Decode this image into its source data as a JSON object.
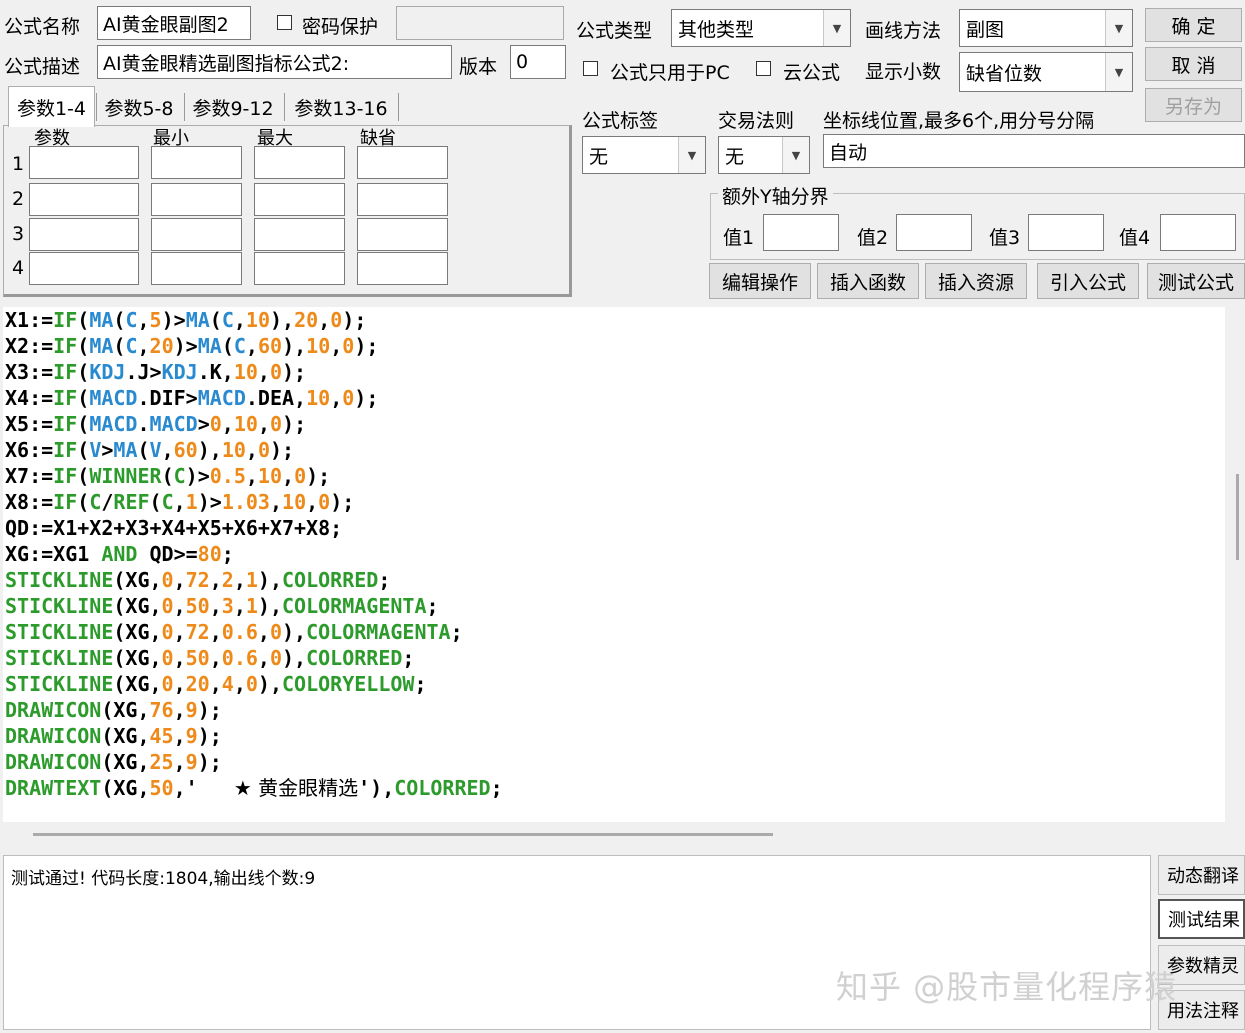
{
  "header": {
    "name_label": "公式名称",
    "name_value": "AI黄金眼副图2",
    "password_label": "密码保护",
    "password_value": "",
    "desc_label": "公式描述",
    "desc_value": "AI黄金眼精选副图指标公式2:",
    "version_label": "版本",
    "version_value": "0",
    "type_label": "公式类型",
    "type_value": "其他类型",
    "draw_label": "画线方法",
    "draw_value": "副图",
    "pc_only_label": "公式只用于PC",
    "cloud_label": "云公式",
    "decimal_label": "显示小数",
    "decimal_value": "缺省位数"
  },
  "buttons": {
    "ok": "确 定",
    "cancel": "取 消",
    "save_as": "另存为"
  },
  "tabs": [
    "参数1-4",
    "参数5-8",
    "参数9-12",
    "参数13-16"
  ],
  "params": {
    "headers": [
      "参数",
      "最小",
      "最大",
      "缺省"
    ],
    "rows": [
      "1",
      "2",
      "3",
      "4"
    ]
  },
  "tags": {
    "tag_label": "公式标签",
    "tag_value": "无",
    "rule_label": "交易法则",
    "rule_value": "无",
    "axis_label": "坐标线位置,最多6个,用分号分隔",
    "axis_value": "自动"
  },
  "extra_axis": {
    "title": "额外Y轴分界",
    "v1": "值1",
    "v2": "值2",
    "v3": "值3",
    "v4": "值4"
  },
  "toolbar": [
    "编辑操作",
    "插入函数",
    "插入资源",
    "引入公式",
    "测试公式"
  ],
  "code": [
    [
      [
        "p",
        "X1:="
      ],
      [
        "f",
        "IF"
      ],
      [
        "p",
        "("
      ],
      [
        "i",
        "MA"
      ],
      [
        "p",
        "("
      ],
      [
        "i",
        "C"
      ],
      [
        "p",
        ","
      ],
      [
        "n",
        "5"
      ],
      [
        "p",
        ")>"
      ],
      [
        "i",
        "MA"
      ],
      [
        "p",
        "("
      ],
      [
        "i",
        "C"
      ],
      [
        "p",
        ","
      ],
      [
        "n",
        "10"
      ],
      [
        "p",
        "),"
      ],
      [
        "n",
        "20"
      ],
      [
        "p",
        ","
      ],
      [
        "n",
        "0"
      ],
      [
        "p",
        ");"
      ]
    ],
    [
      [
        "p",
        "X2:="
      ],
      [
        "f",
        "IF"
      ],
      [
        "p",
        "("
      ],
      [
        "i",
        "MA"
      ],
      [
        "p",
        "("
      ],
      [
        "i",
        "C"
      ],
      [
        "p",
        ","
      ],
      [
        "n",
        "20"
      ],
      [
        "p",
        ")>"
      ],
      [
        "i",
        "MA"
      ],
      [
        "p",
        "("
      ],
      [
        "i",
        "C"
      ],
      [
        "p",
        ","
      ],
      [
        "n",
        "60"
      ],
      [
        "p",
        "),"
      ],
      [
        "n",
        "10"
      ],
      [
        "p",
        ","
      ],
      [
        "n",
        "0"
      ],
      [
        "p",
        ");"
      ]
    ],
    [
      [
        "p",
        "X3:="
      ],
      [
        "f",
        "IF"
      ],
      [
        "p",
        "("
      ],
      [
        "i",
        "KDJ"
      ],
      [
        "p",
        ".J>"
      ],
      [
        "i",
        "KDJ"
      ],
      [
        "p",
        ".K,"
      ],
      [
        "n",
        "10"
      ],
      [
        "p",
        ","
      ],
      [
        "n",
        "0"
      ],
      [
        "p",
        ");"
      ]
    ],
    [
      [
        "p",
        "X4:="
      ],
      [
        "f",
        "IF"
      ],
      [
        "p",
        "("
      ],
      [
        "i",
        "MACD"
      ],
      [
        "p",
        ".DIF>"
      ],
      [
        "i",
        "MACD"
      ],
      [
        "p",
        ".DEA,"
      ],
      [
        "n",
        "10"
      ],
      [
        "p",
        ","
      ],
      [
        "n",
        "0"
      ],
      [
        "p",
        ");"
      ]
    ],
    [
      [
        "p",
        "X5:="
      ],
      [
        "f",
        "IF"
      ],
      [
        "p",
        "("
      ],
      [
        "i",
        "MACD"
      ],
      [
        "p",
        "."
      ],
      [
        "i",
        "MACD"
      ],
      [
        "p",
        ">"
      ],
      [
        "n",
        "0"
      ],
      [
        "p",
        ","
      ],
      [
        "n",
        "10"
      ],
      [
        "p",
        ","
      ],
      [
        "n",
        "0"
      ],
      [
        "p",
        ");"
      ]
    ],
    [
      [
        "p",
        "X6:="
      ],
      [
        "f",
        "IF"
      ],
      [
        "p",
        "("
      ],
      [
        "i",
        "V"
      ],
      [
        "p",
        ">"
      ],
      [
        "i",
        "MA"
      ],
      [
        "p",
        "("
      ],
      [
        "i",
        "V"
      ],
      [
        "p",
        ","
      ],
      [
        "n",
        "60"
      ],
      [
        "p",
        "),"
      ],
      [
        "n",
        "10"
      ],
      [
        "p",
        ","
      ],
      [
        "n",
        "0"
      ],
      [
        "p",
        ");"
      ]
    ],
    [
      [
        "p",
        "X7:="
      ],
      [
        "f",
        "IF"
      ],
      [
        "p",
        "("
      ],
      [
        "f",
        "WINNER"
      ],
      [
        "p",
        "("
      ],
      [
        "f",
        "C"
      ],
      [
        "p",
        ")>"
      ],
      [
        "n",
        "0.5"
      ],
      [
        "p",
        ","
      ],
      [
        "n",
        "10"
      ],
      [
        "p",
        ","
      ],
      [
        "n",
        "0"
      ],
      [
        "p",
        ");"
      ]
    ],
    [
      [
        "p",
        "X8:="
      ],
      [
        "f",
        "IF"
      ],
      [
        "p",
        "("
      ],
      [
        "f",
        "C"
      ],
      [
        "p",
        "/"
      ],
      [
        "f",
        "REF"
      ],
      [
        "p",
        "("
      ],
      [
        "f",
        "C"
      ],
      [
        "p",
        ","
      ],
      [
        "n",
        "1"
      ],
      [
        "p",
        ")>"
      ],
      [
        "n",
        "1.03"
      ],
      [
        "p",
        ","
      ],
      [
        "n",
        "10"
      ],
      [
        "p",
        ","
      ],
      [
        "n",
        "0"
      ],
      [
        "p",
        ");"
      ]
    ],
    [
      [
        "p",
        "QD:=X1+X2+X3+X4+X5+X6+X7+X8;"
      ]
    ],
    [
      [
        "p",
        "XG:=XG1 "
      ],
      [
        "f",
        "AND"
      ],
      [
        "p",
        " QD>="
      ],
      [
        "n",
        "80"
      ],
      [
        "p",
        ";"
      ]
    ],
    [
      [
        "f",
        "STICKLINE"
      ],
      [
        "p",
        "(XG,"
      ],
      [
        "n",
        "0"
      ],
      [
        "p",
        ","
      ],
      [
        "n",
        "72"
      ],
      [
        "p",
        ","
      ],
      [
        "n",
        "2"
      ],
      [
        "p",
        ","
      ],
      [
        "n",
        "1"
      ],
      [
        "p",
        "),"
      ],
      [
        "f",
        "COLORRED"
      ],
      [
        "p",
        ";"
      ]
    ],
    [
      [
        "f",
        "STICKLINE"
      ],
      [
        "p",
        "(XG,"
      ],
      [
        "n",
        "0"
      ],
      [
        "p",
        ","
      ],
      [
        "n",
        "50"
      ],
      [
        "p",
        ","
      ],
      [
        "n",
        "3"
      ],
      [
        "p",
        ","
      ],
      [
        "n",
        "1"
      ],
      [
        "p",
        "),"
      ],
      [
        "f",
        "COLORMAGENTA"
      ],
      [
        "p",
        ";"
      ]
    ],
    [
      [
        "f",
        "STICKLINE"
      ],
      [
        "p",
        "(XG,"
      ],
      [
        "n",
        "0"
      ],
      [
        "p",
        ","
      ],
      [
        "n",
        "72"
      ],
      [
        "p",
        ","
      ],
      [
        "n",
        "0.6"
      ],
      [
        "p",
        ","
      ],
      [
        "n",
        "0"
      ],
      [
        "p",
        "),"
      ],
      [
        "f",
        "COLORMAGENTA"
      ],
      [
        "p",
        ";"
      ]
    ],
    [
      [
        "f",
        "STICKLINE"
      ],
      [
        "p",
        "(XG,"
      ],
      [
        "n",
        "0"
      ],
      [
        "p",
        ","
      ],
      [
        "n",
        "50"
      ],
      [
        "p",
        ","
      ],
      [
        "n",
        "0.6"
      ],
      [
        "p",
        ","
      ],
      [
        "n",
        "0"
      ],
      [
        "p",
        "),"
      ],
      [
        "f",
        "COLORRED"
      ],
      [
        "p",
        ";"
      ]
    ],
    [
      [
        "f",
        "STICKLINE"
      ],
      [
        "p",
        "(XG,"
      ],
      [
        "n",
        "0"
      ],
      [
        "p",
        ","
      ],
      [
        "n",
        "20"
      ],
      [
        "p",
        ","
      ],
      [
        "n",
        "4"
      ],
      [
        "p",
        ","
      ],
      [
        "n",
        "0"
      ],
      [
        "p",
        "),"
      ],
      [
        "f",
        "COLORYELLOW"
      ],
      [
        "p",
        ";"
      ]
    ],
    [
      [
        "f",
        "DRAWICON"
      ],
      [
        "p",
        "(XG,"
      ],
      [
        "n",
        "76"
      ],
      [
        "p",
        ","
      ],
      [
        "n",
        "9"
      ],
      [
        "p",
        ");"
      ]
    ],
    [
      [
        "f",
        "DRAWICON"
      ],
      [
        "p",
        "(XG,"
      ],
      [
        "n",
        "45"
      ],
      [
        "p",
        ","
      ],
      [
        "n",
        "9"
      ],
      [
        "p",
        ");"
      ]
    ],
    [
      [
        "f",
        "DRAWICON"
      ],
      [
        "p",
        "(XG,"
      ],
      [
        "n",
        "25"
      ],
      [
        "p",
        ","
      ],
      [
        "n",
        "9"
      ],
      [
        "p",
        ");"
      ]
    ],
    [
      [
        "f",
        "DRAWTEXT"
      ],
      [
        "p",
        "(XG,"
      ],
      [
        "n",
        "50"
      ],
      [
        "p",
        ",'   "
      ],
      [
        "s",
        "★"
      ],
      [
        "c",
        " 黄金眼精选"
      ],
      [
        "p",
        "'),"
      ],
      [
        "f",
        "COLORRED"
      ],
      [
        "p",
        ";"
      ]
    ]
  ],
  "colors": {
    "function": "#2c9b2c",
    "indicator": "#2a8ad0",
    "number": "#ee8a1a"
  },
  "result_text": "测试通过! 代码长度:1804,输出线个数:9",
  "side_tabs": [
    "动态翻译",
    "测试结果",
    "参数精灵",
    "用法注释"
  ],
  "watermark": "知乎 @股市量化程序猿"
}
